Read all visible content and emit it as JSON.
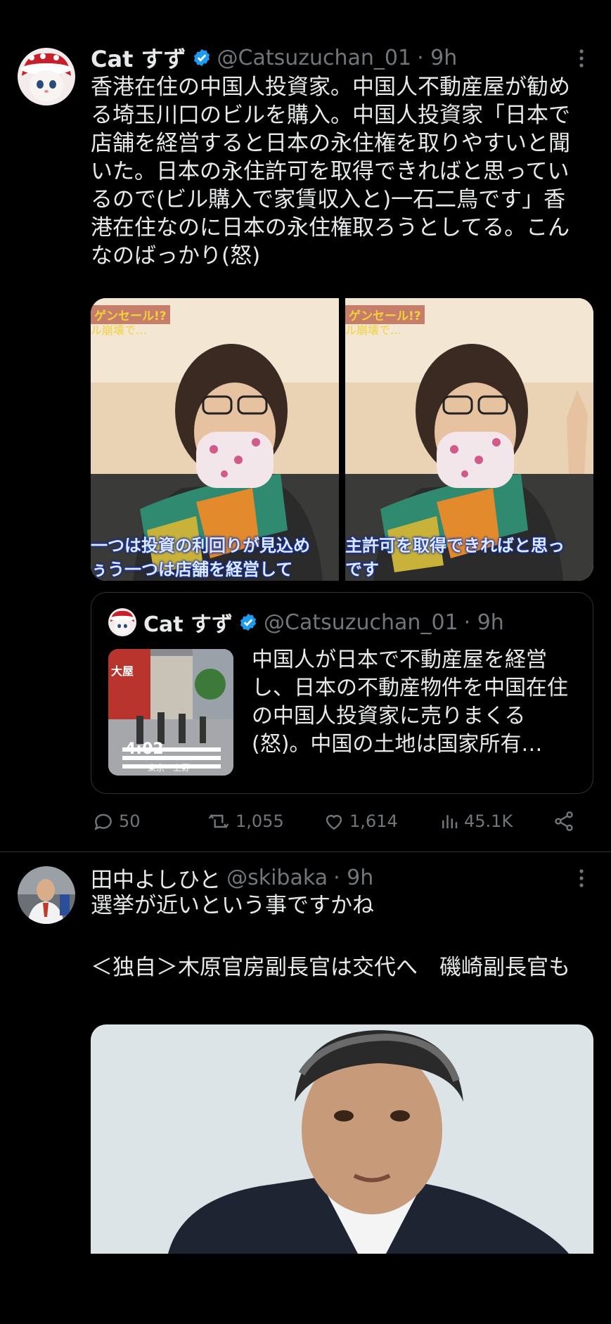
{
  "post1": {
    "display_name": "Cat すず",
    "handle": "@Catsuzuchan_01",
    "time": "· 9h",
    "text": "香港在住の中国人投資家。中国人不動産屋が勧める埼玉川口のビルを購入。中国人投資家「日本で店舗を経営すると日本の永住権を取りやすいと聞いた。日本の永住許可を取得できればと思っているので(ビル購入で家賃収入と)一石二鳥です」香港在住なのに日本の永住権取ろうとしてる。こんなのばっかり(怒)",
    "media": {
      "left_caption_top1": "ゲンセール!?",
      "left_caption_top2": "ル崩壊で…",
      "left_sub1": "一つは投資の利回りが見込め",
      "left_sub2": "ぅう一つは店舗を経営して",
      "right_caption_top1": "ゲンセール!?",
      "right_caption_top2": "ル崩壊で…",
      "right_sub1": "主許可を取得できればと思っ",
      "right_sub2": "です"
    },
    "quote": {
      "display_name": "Cat すず",
      "handle": "@Catsuzuchan_01",
      "time": "· 9h",
      "video_duration": "4:02",
      "thumb_sign": "東京・上野",
      "thumb_store": "大屋",
      "text": "中国人が日本で不動産屋を経営し、日本の不動産物件を中国在住の中国人投資家に売りまくる(怒)。中国の土地は国家所有…"
    },
    "actions": {
      "replies": "50",
      "reposts": "1,055",
      "likes": "1,614",
      "views": "45.1K"
    }
  },
  "post2": {
    "display_name": "田中よしひと",
    "handle": "@skibaka",
    "time": "· 9h",
    "text_line1": "選挙が近いという事ですかね",
    "text_line2": "＜独自＞木原官房副長官は交代へ　磯崎副長官も"
  },
  "colors": {
    "background": "#000000",
    "text": "#e7e9ea",
    "muted": "#71767b",
    "verified": "#1d9bf0",
    "border": "#2f3336"
  }
}
